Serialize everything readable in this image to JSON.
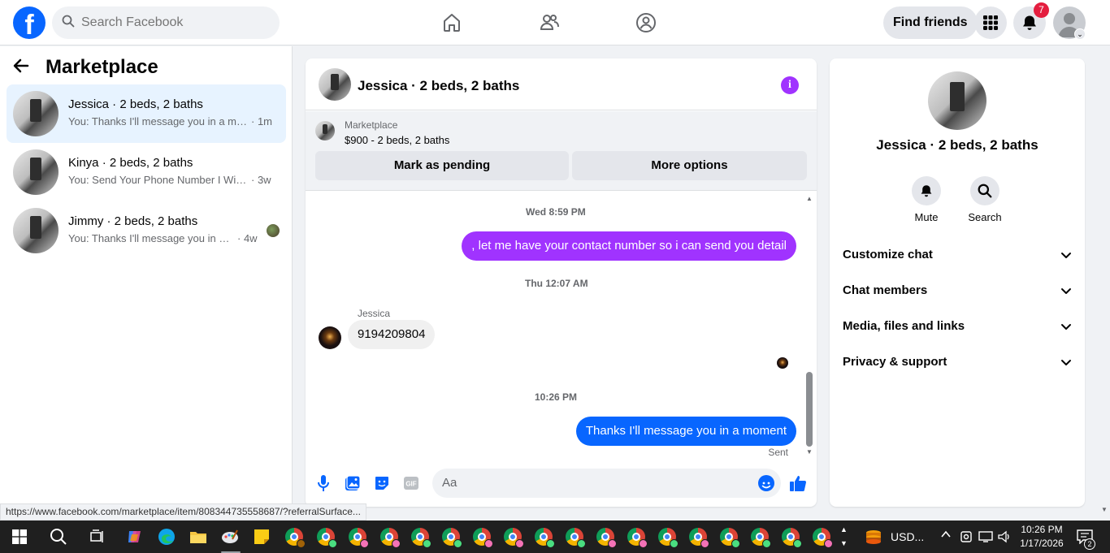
{
  "topbar": {
    "logo": "f",
    "search_placeholder": "Search Facebook",
    "find_friends_label": "Find friends",
    "notification_count": "7",
    "icons": [
      "home-icon",
      "friends-icon",
      "groups-icon",
      "menu-grid-icon",
      "bell-icon"
    ]
  },
  "left": {
    "title": "Marketplace",
    "conversations": [
      {
        "name": "Jessica · 2 beds, 2 baths",
        "snippet": "You: Thanks I'll message you in a mo...",
        "time": "· 1m",
        "active": true
      },
      {
        "name": "Kinya · 2 beds, 2 baths",
        "snippet": "You: Send Your Phone Number I Will ...",
        "time": "· 3w",
        "active": false
      },
      {
        "name": "Jimmy · 2 beds, 2 baths",
        "snippet": "You: Thanks I'll message you in a ...",
        "time": "· 4w",
        "active": false
      }
    ]
  },
  "chat": {
    "title": "Jessica · 2 beds, 2 baths",
    "marketplace_label": "Marketplace",
    "listing": "$900 - 2 beds, 2 baths",
    "mark_pending_label": "Mark as pending",
    "more_options_label": "More options",
    "messages": [
      {
        "type": "timestamp",
        "text": "Wed 8:59 PM"
      },
      {
        "type": "out",
        "text": ", let me have your contact number so i can send you detail",
        "color": "#a033ff"
      },
      {
        "type": "timestamp",
        "text": "Thu 12:07 AM"
      },
      {
        "type": "sender",
        "text": "Jessica"
      },
      {
        "type": "in",
        "text": "9194209804"
      },
      {
        "type": "timestamp",
        "text": "10:26 PM"
      },
      {
        "type": "out",
        "text": "Thanks I'll message you in a moment",
        "color": "#0866ff"
      },
      {
        "type": "status",
        "text": "Sent"
      }
    ],
    "composer_placeholder": "Aa",
    "accent": "#0866ff"
  },
  "right": {
    "name": "Jessica · 2 beds, 2 baths",
    "mute_label": "Mute",
    "search_label": "Search",
    "menu": [
      "Customize chat",
      "Chat members",
      "Media, files and links",
      "Privacy & support"
    ]
  },
  "status_url": "https://www.facebook.com/marketplace/item/808344735558687/?referralSurface...",
  "taskbar": {
    "tray_currency": "USD...",
    "time": "10:26 PM",
    "date": "1/17/2026",
    "notif_count": "2"
  }
}
